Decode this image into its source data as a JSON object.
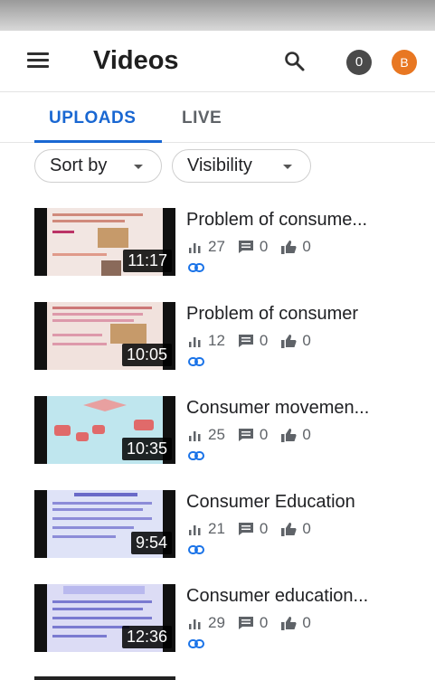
{
  "header": {
    "title": "Videos",
    "notification_count": "0",
    "avatar_letter": "B"
  },
  "tabs": [
    {
      "label": "UPLOADS",
      "active": true
    },
    {
      "label": "LIVE",
      "active": false
    }
  ],
  "filters": {
    "sort_label": "Sort by",
    "visibility_label": "Visibility"
  },
  "videos": [
    {
      "title": "Problem of consume...",
      "duration": "11:17",
      "views": "27",
      "comments": "0",
      "likes": "0",
      "thumb_bg": "#f2e6e2"
    },
    {
      "title": "Problem of consumer",
      "duration": "10:05",
      "views": "12",
      "comments": "0",
      "likes": "0",
      "thumb_bg": "#f1e2dd"
    },
    {
      "title": "Consumer movemen...",
      "duration": "10:35",
      "views": "25",
      "comments": "0",
      "likes": "0",
      "thumb_bg": "#bfe6ee"
    },
    {
      "title": "Consumer Education",
      "duration": "9:54",
      "views": "21",
      "comments": "0",
      "likes": "0",
      "thumb_bg": "#dfe3f7"
    },
    {
      "title": "Consumer education...",
      "duration": "12:36",
      "views": "29",
      "comments": "0",
      "likes": "0",
      "thumb_bg": "#dcdcf5"
    }
  ],
  "colors": {
    "accent": "#1967d2",
    "avatar": "#e87722",
    "link": "#1a73e8"
  }
}
